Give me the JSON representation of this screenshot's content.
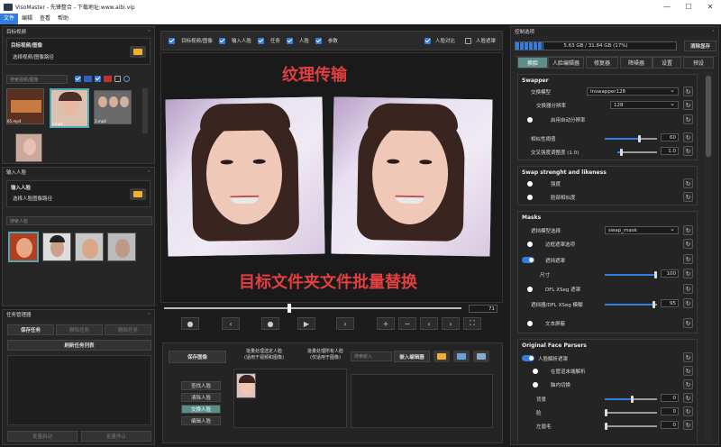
{
  "titlebar": {
    "title": "VisoMaster - 先锋整合 - 下载地址:www.aibi.vip"
  },
  "menu": [
    "文件",
    "编辑",
    "查看",
    "帮助"
  ],
  "left": {
    "target_panel_title": "目标视频",
    "target_label": "目标视频/图像",
    "target_select": "选择视频/图像路径",
    "target_search": "搜索视频/图像",
    "target_thumbs": [
      "65.mp4",
      "1.mp4",
      "2.mp4",
      ""
    ],
    "input_panel_title": "输入人脸",
    "input_label": "输入人脸",
    "input_select": "选择人脸图像路径",
    "input_search": "搜索人脸",
    "task_panel_title": "任务管理器",
    "task_buttons": [
      "保存任务",
      "删除任务",
      "删除任务"
    ],
    "refresh_btn": "刷新任务列表",
    "bottom_btns": [
      "批量启动",
      "批量停止"
    ]
  },
  "center": {
    "checks": [
      "目标视频/图像",
      "输入人脸",
      "任务",
      "人脸",
      "参数"
    ],
    "checks_right": [
      "人脸对比",
      "人脸遮罩"
    ],
    "frame_number": "71",
    "anno_top": "纹理传输",
    "anno_bottom": "目标文件夹文件批量替换",
    "save_image": "保存图像",
    "batch_label_1": "批量处理选定人脸\n(适用于视频和图像)",
    "batch_label_2": "批量处理所有人脸\n(仅适用于图像)",
    "search_placeholder": "搜索嵌入",
    "embed_btn": "嵌入编辑器",
    "face_btns": [
      "查找人脸",
      "清除人脸",
      "交换人脸",
      "编辑人脸"
    ]
  },
  "right": {
    "panel_title": "控制选项",
    "memory": "5.63 GB / 31.84 GB (17%)",
    "clear_mem": "清除显存",
    "tabs": [
      "换脸",
      "人脸编辑器",
      "修复器",
      "降噪器",
      "设置",
      "预设"
    ],
    "swapper": {
      "title": "Swapper",
      "model_label": "交换模型",
      "model": "Inswapper128",
      "res_label": "交换器分辨率",
      "res": "128",
      "auto_res": "启用自动分辨率",
      "sim_label": "相似性阈值",
      "sim": "60",
      "strength_label": "交叉强度调整度 (1.0)",
      "strength": "1.0"
    },
    "like": {
      "title": "Swap strenght and likeness",
      "opt1": "强度",
      "opt2": "脸部相似度"
    },
    "masks": {
      "title": "Masks",
      "occluder_label": "遮挡模型选择",
      "occluder": "swap_mask",
      "border": "边框遮罩选项",
      "occ_toggle": "遮挡遮罩",
      "size_label": "尺寸",
      "size": "100",
      "xseg": "DFL XSeg 遮罩",
      "xseg_label": "遮挡器/DFL XSeg 模糊",
      "xseg_val": "95",
      "text": "文本屏蔽"
    },
    "parsers": {
      "title": "Original Face Parsers",
      "toggle": "人脸解析遮罩",
      "opt1": "在管道末端解析",
      "opt2": "脑内切换",
      "bg_label": "背景",
      "bg": "0",
      "face_label": "脸",
      "face": "0",
      "brow_label": "左眉毛",
      "brow": "0"
    }
  }
}
